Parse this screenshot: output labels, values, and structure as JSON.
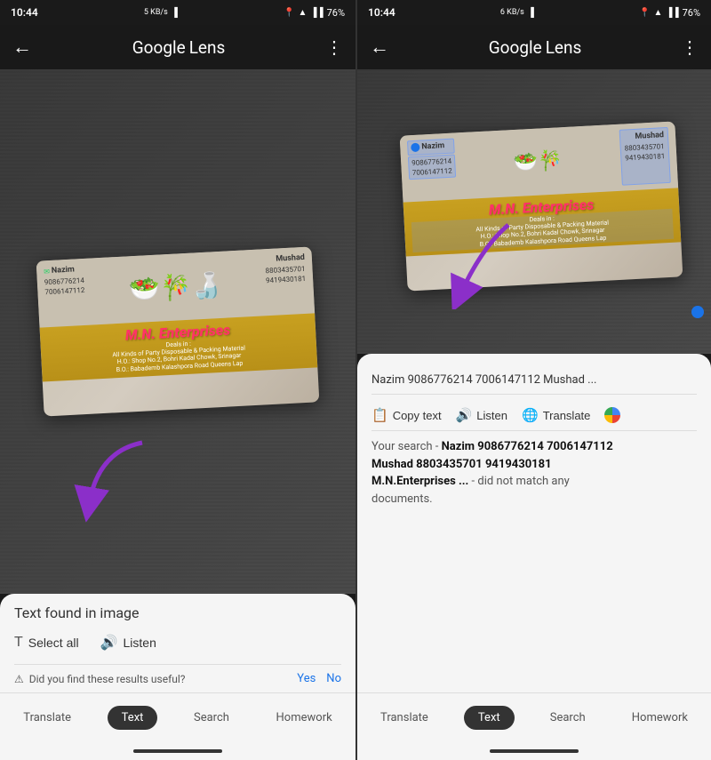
{
  "left_panel": {
    "status_bar": {
      "time": "10:44",
      "kb_speed": "5 KB/s",
      "battery": "76%",
      "location_icon": "location-pin-icon",
      "wifi_icon": "wifi-icon",
      "signal_icon": "signal-icon",
      "battery_icon": "battery-icon"
    },
    "top_bar": {
      "back_icon": "←",
      "title": "Google Lens",
      "menu_icon": "⋮"
    },
    "card": {
      "left_name": "Nazim",
      "left_phone1": "9086776214",
      "left_phone2": "7006147112",
      "right_name": "Mushad",
      "right_phone1": "8803435701",
      "right_phone2": "9419430181",
      "company": "M.N. Enterprises",
      "deals_line1": "Deals in :",
      "deals_line2": "All Kinds of Party Disposable & Packing Material",
      "address_line1": "H.O.: Shop No.2, Bohri Kadal Chowk, Srinagar",
      "address_line2": "B.O.: Babademb Kalashpora Road Queens Lap"
    },
    "bottom_panel": {
      "text_found": "Text found in image",
      "select_all": "Select all",
      "listen": "Listen",
      "feedback_question": "Did you find these results useful?",
      "yes": "Yes",
      "no": "No"
    },
    "bottom_nav": {
      "translate": "Translate",
      "text": "Text",
      "search": "Search",
      "homework": "Homework"
    }
  },
  "right_panel": {
    "status_bar": {
      "time": "10:44",
      "kb_speed": "6 KB/s",
      "battery": "76%"
    },
    "top_bar": {
      "back_icon": "←",
      "title": "Google Lens",
      "menu_icon": "⋮"
    },
    "result_query": "Nazim 9086776214 7006147112 Mushad ...",
    "actions": {
      "copy_text": "Copy text",
      "listen": "Listen",
      "translate": "Translate",
      "google_icon": "google-icon"
    },
    "search_results": {
      "line1": "Your search -",
      "bold1": "Nazim 9086776214 7006147112",
      "line2": "Mushad 8803435701 9419430181",
      "bold2": "M.N.Enterprises",
      "line3": "... - did not match any",
      "line4": "documents."
    },
    "bottom_nav": {
      "translate": "Translate",
      "text": "Text",
      "search": "Search",
      "homework": "Homework"
    }
  }
}
